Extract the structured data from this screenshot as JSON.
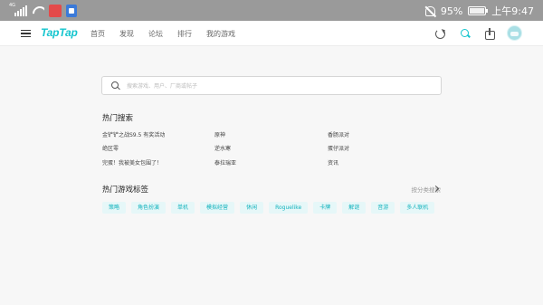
{
  "status_bar": {
    "network": "4G",
    "battery": "95%",
    "time": "上午9:47",
    "battery_icon": "battery-icon",
    "mute_icon": "bell-off-icon"
  },
  "nav": {
    "logo": "TapTap",
    "tabs": [
      "首页",
      "发现",
      "论坛",
      "排行",
      "我的游戏"
    ]
  },
  "search": {
    "placeholder": "搜索游戏、用户、厂商或帖子"
  },
  "hot_search": {
    "title": "热门搜索",
    "items": [
      "金铲铲之战S9.5 有奖活动",
      "原神",
      "香肠派对",
      "绝区零",
      "逆水寒",
      "蛋仔派对",
      "完蛋！我被美女包围了！",
      "泰拉瑞亚",
      "资讯"
    ]
  },
  "hot_tags": {
    "title": "热门游戏标签",
    "more_label": "按分类搜索",
    "tags": [
      "策略",
      "角色扮演",
      "单机",
      "模拟经营",
      "休闲",
      "Roguelike",
      "卡牌",
      "解谜",
      "音游",
      "多人联机"
    ]
  },
  "colors": {
    "accent": "#15c5ce",
    "status_bar": "#9a9a9a",
    "background": "#f7f7f7",
    "tag_bg": "#e6f7f8"
  }
}
